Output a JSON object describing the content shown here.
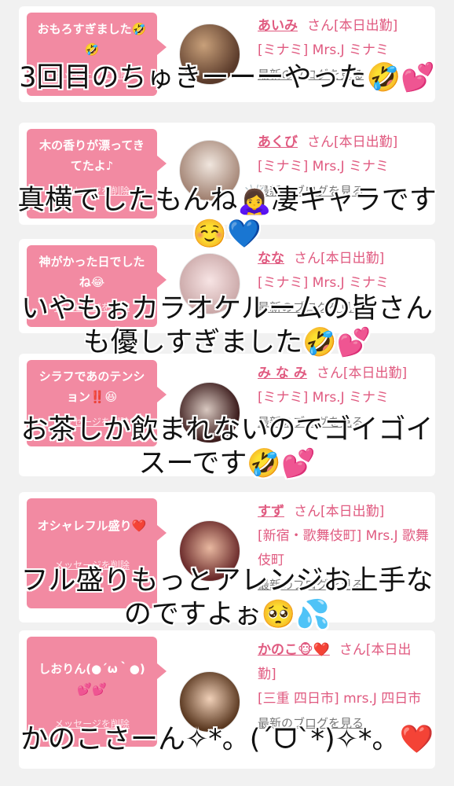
{
  "cards": [
    {
      "message": "おもろすぎました🤣🤣",
      "delete": "メッセージを削除",
      "name": "あいみ",
      "suffix": "さん[本日出勤]",
      "shop": "[ミナミ] Mrs.J ミナミ",
      "blog": "最新のブログを見る"
    },
    {
      "message": "木の香りが漂ってきてたよ♪",
      "delete": "メッセージを削除",
      "name": "あくび",
      "suffix": "さん[本日出勤]",
      "shop": "[ミナミ] Mrs.J ミナミ",
      "blog": "最新のブログを見る"
    },
    {
      "message": "神がかった日でしたね😂",
      "delete": "メッセージを削除",
      "name": "なな",
      "suffix": "さん[本日出勤]",
      "shop": "[ミナミ] Mrs.J ミナミ",
      "blog": "最新のブログを見る"
    },
    {
      "message": "シラフであのテンション‼️😆",
      "delete": "メッセージを削除",
      "name": "み な み",
      "suffix": "さん[本日出勤]",
      "shop": "[ミナミ] Mrs.J ミナミ",
      "blog": "最新のブログを見る"
    },
    {
      "message": "オシャレフル盛り❤️",
      "delete": "メッセージを削除",
      "name": "すず",
      "suffix": "さん[本日出勤]",
      "shop": "[新宿・歌舞伎町] Mrs.J 歌舞伎町",
      "blog": "最新のブログを見る"
    },
    {
      "message": "しおりん(●´ω｀●)💕💕",
      "delete": "メッセージを削除",
      "name": "かのこ🐵❤️",
      "suffix": "さん[本日出勤]",
      "shop": "[三重 四日市] mrs.J 四日市",
      "blog": "最新のブログを見る"
    }
  ],
  "overlay": [
    "3回目のちゅきーーーやった🤣💕",
    "真横でしたもんね🙇‍♀️凄キャラです☺️💙",
    "いやもぉカラオケルームの皆さんも優しすぎました🤣💕",
    "お茶しか飲まれないのでゴイゴイスーです🤣💕",
    "フル盛りもっとアレンジお上手なのですよぉ🥺💦",
    "かのこさーん✧*。(ˊᗜˋ*)✧*。❤️"
  ],
  "colors": {
    "bubble": "#f28aa2",
    "name": "#e05a80",
    "background": "#f1f1f1"
  }
}
